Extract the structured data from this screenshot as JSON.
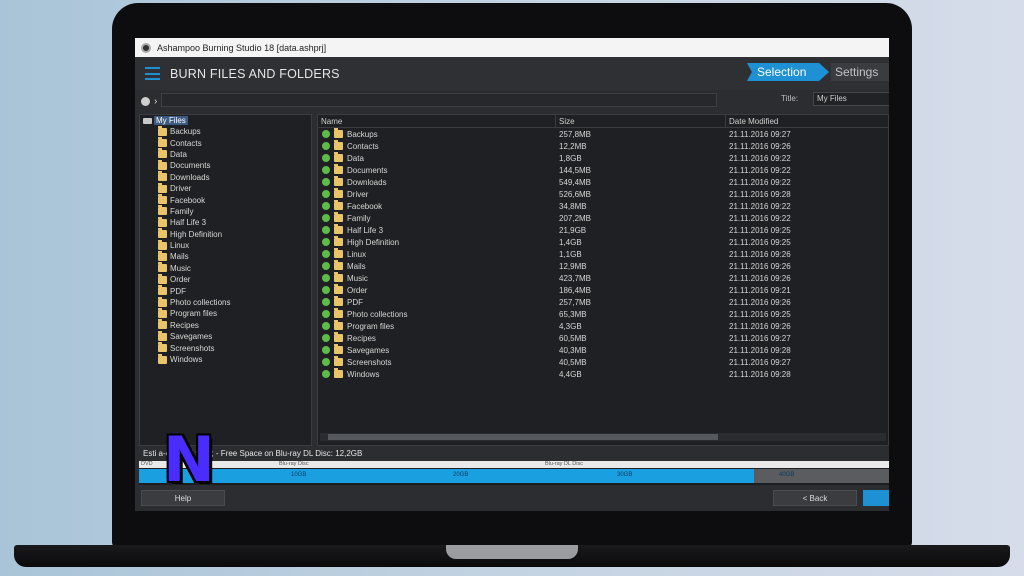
{
  "window": {
    "title": "Ashampoo Burning Studio 18 [data.ashprj]"
  },
  "header": {
    "title": "BURN FILES AND FOLDERS"
  },
  "tabs": {
    "selection": "Selection",
    "settings": "Settings"
  },
  "disc_title": {
    "label": "Title:",
    "value": "My Files"
  },
  "tree": {
    "root": "My Files",
    "items": [
      "Backups",
      "Contacts",
      "Data",
      "Documents",
      "Downloads",
      "Driver",
      "Facebook",
      "Family",
      "Half Life 3",
      "High Definition",
      "Linux",
      "Mails",
      "Music",
      "Order",
      "PDF",
      "Photo collections",
      "Program files",
      "Recipes",
      "Savegames",
      "Screenshots",
      "Windows"
    ]
  },
  "columns": {
    "name": "Name",
    "size": "Size",
    "date": "Date Modified"
  },
  "files": [
    {
      "name": "Backups",
      "size": "257,8MB",
      "date": "21.11.2016 09:27"
    },
    {
      "name": "Contacts",
      "size": "12,2MB",
      "date": "21.11.2016 09:26"
    },
    {
      "name": "Data",
      "size": "1,8GB",
      "date": "21.11.2016 09:22"
    },
    {
      "name": "Documents",
      "size": "144,5MB",
      "date": "21.11.2016 09:22"
    },
    {
      "name": "Downloads",
      "size": "549,4MB",
      "date": "21.11.2016 09:22"
    },
    {
      "name": "Driver",
      "size": "526,6MB",
      "date": "21.11.2016 09:28"
    },
    {
      "name": "Facebook",
      "size": "34,8MB",
      "date": "21.11.2016 09:22"
    },
    {
      "name": "Family",
      "size": "207,2MB",
      "date": "21.11.2016 09:22"
    },
    {
      "name": "Half Life 3",
      "size": "21,9GB",
      "date": "21.11.2016 09:25"
    },
    {
      "name": "High Definition",
      "size": "1,4GB",
      "date": "21.11.2016 09:25"
    },
    {
      "name": "Linux",
      "size": "1,1GB",
      "date": "21.11.2016 09:26"
    },
    {
      "name": "Mails",
      "size": "12,9MB",
      "date": "21.11.2016 09:26"
    },
    {
      "name": "Music",
      "size": "423,7MB",
      "date": "21.11.2016 09:26"
    },
    {
      "name": "Order",
      "size": "186,4MB",
      "date": "21.11.2016 09:21"
    },
    {
      "name": "PDF",
      "size": "257,7MB",
      "date": "21.11.2016 09:26"
    },
    {
      "name": "Photo collections",
      "size": "65,3MB",
      "date": "21.11.2016 09:25"
    },
    {
      "name": "Program files",
      "size": "4,3GB",
      "date": "21.11.2016 09:26"
    },
    {
      "name": "Recipes",
      "size": "60,5MB",
      "date": "21.11.2016 09:27"
    },
    {
      "name": "Savegames",
      "size": "40,3MB",
      "date": "21.11.2016 09:28"
    },
    {
      "name": "Screenshots",
      "size": "40,5MB",
      "date": "21.11.2016 09:27"
    },
    {
      "name": "Windows",
      "size": "4,4GB",
      "date": "21.11.2016 09:28"
    }
  ],
  "status": {
    "info": "Esti                        a-disc: 37,9GB; - Free Space on Blu-ray DL Disc: 12,2GB"
  },
  "capacity": {
    "used_fraction": 0.82,
    "top_labels": [
      "DVD",
      "Blu-ray Disc",
      "Blu-ray DL Disc"
    ],
    "ticks": [
      "10GB",
      "20GB",
      "30GB",
      "40GB"
    ],
    "fill_color": "#1aa0e0"
  },
  "buttons": {
    "help": "Help",
    "back": "< Back"
  },
  "watermark": {
    "letter": "N"
  },
  "colors": {
    "accent": "#1e90d4",
    "folder": "#e9c46a",
    "check": "#5dbb46"
  }
}
